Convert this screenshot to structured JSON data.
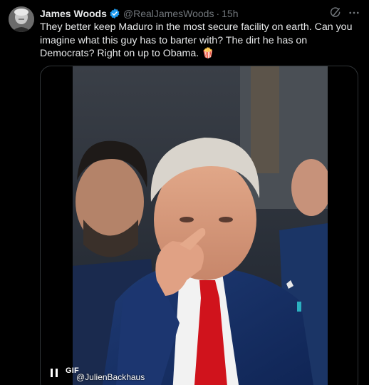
{
  "tweet": {
    "author_name": "James Woods",
    "handle": "@RealJamesWoods",
    "separator": "·",
    "timestamp": "15h",
    "text": "They better keep Maduro in the most secure facility on earth. Can you imagine what this guy has to barter with? The dirt he has on Democrats? Right on up to Obama. 🍿"
  },
  "media": {
    "badge": "GIF",
    "watermark": "@JulienBackhaus"
  },
  "icons": {
    "avatar": "avatar",
    "verified": "verified-badge-icon",
    "grok": "grok-icon",
    "more": "more-options-icon",
    "pause": "pause-icon"
  },
  "colors": {
    "background": "#000000",
    "text": "#e7e9ea",
    "muted": "#71767b",
    "verified": "#1d9bf0",
    "border": "#2f3336"
  }
}
